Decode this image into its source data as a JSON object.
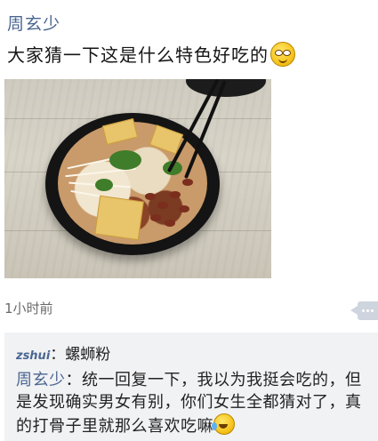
{
  "post": {
    "author": "周玄少",
    "text": "大家猜一下这是什么特色好吃的",
    "emoji_icon": "grinning-face-icon",
    "timestamp": "1小时前"
  },
  "photo": {
    "description_icon": "noodle-bowl-photo"
  },
  "comments": [
    {
      "author": "zshui",
      "separator": "：",
      "text": "螺蛳粉"
    },
    {
      "author": "周玄少",
      "separator": "：",
      "text": "统一回复一下，我以为我挺会吃的，但是发现确实男女有别，你们女生全都猜对了，真的打骨子里就那么喜欢吃嘛",
      "emoji_icon": "laughing-tears-icon"
    }
  ],
  "colors": {
    "name_blue": "#4a6690",
    "comment_bg": "#f1f2f4",
    "action_bg": "#cfd5df"
  }
}
